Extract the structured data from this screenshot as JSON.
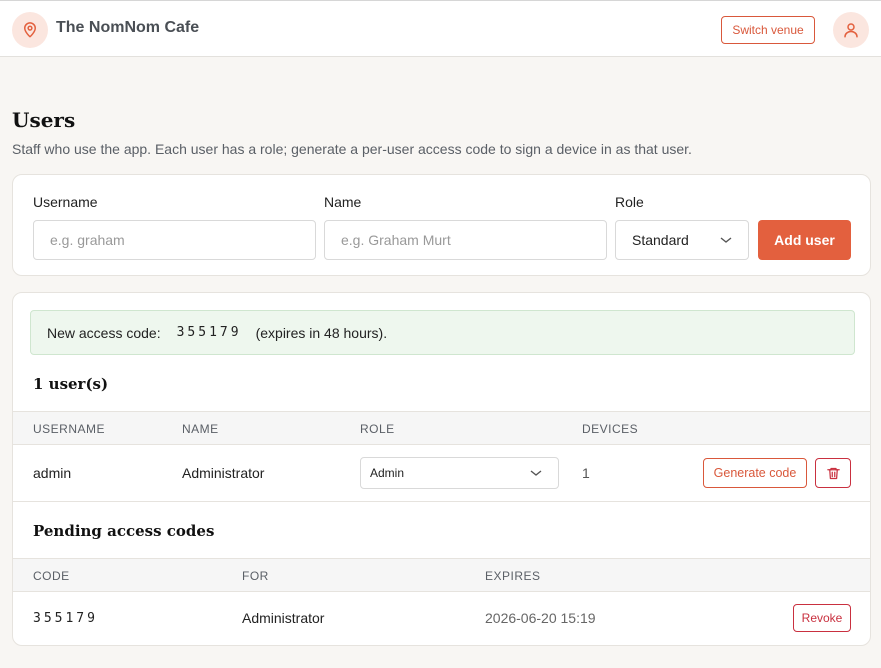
{
  "header": {
    "title": "The NomNom Cafe",
    "switch_label": "Switch venue",
    "logo_icon": "map-pin-icon",
    "avatar_icon": "user-icon"
  },
  "page": {
    "title": "Users",
    "description": "Staff who use the app. Each user has a role; generate a per-user access code to sign a device in as that user."
  },
  "form": {
    "username_label": "Username",
    "username_placeholder": "e.g. graham",
    "name_label": "Name",
    "name_placeholder": "e.g. Graham Murt",
    "role_label": "Role",
    "role_value": "Standard",
    "add_label": "Add user"
  },
  "notice": {
    "prefix": "New access code:",
    "code": "355179",
    "suffix": "(expires in 48 hours)."
  },
  "users": {
    "count_title": "1 user(s)",
    "columns": [
      "USERNAME",
      "NAME",
      "ROLE",
      "DEVICES"
    ],
    "rows": [
      {
        "username": "admin",
        "name": "Administrator",
        "role": "Admin",
        "devices": "1",
        "generate_label": "Generate code"
      }
    ]
  },
  "pending": {
    "title": "Pending access codes",
    "columns": [
      "CODE",
      "FOR",
      "EXPIRES"
    ],
    "rows": [
      {
        "code": "355179",
        "for": "Administrator",
        "expires": "2026-06-20 15:19",
        "revoke_label": "Revoke"
      }
    ]
  },
  "colors": {
    "accent": "#e3603e",
    "danger": "#c9303f",
    "success_bg": "#eef7ee"
  }
}
